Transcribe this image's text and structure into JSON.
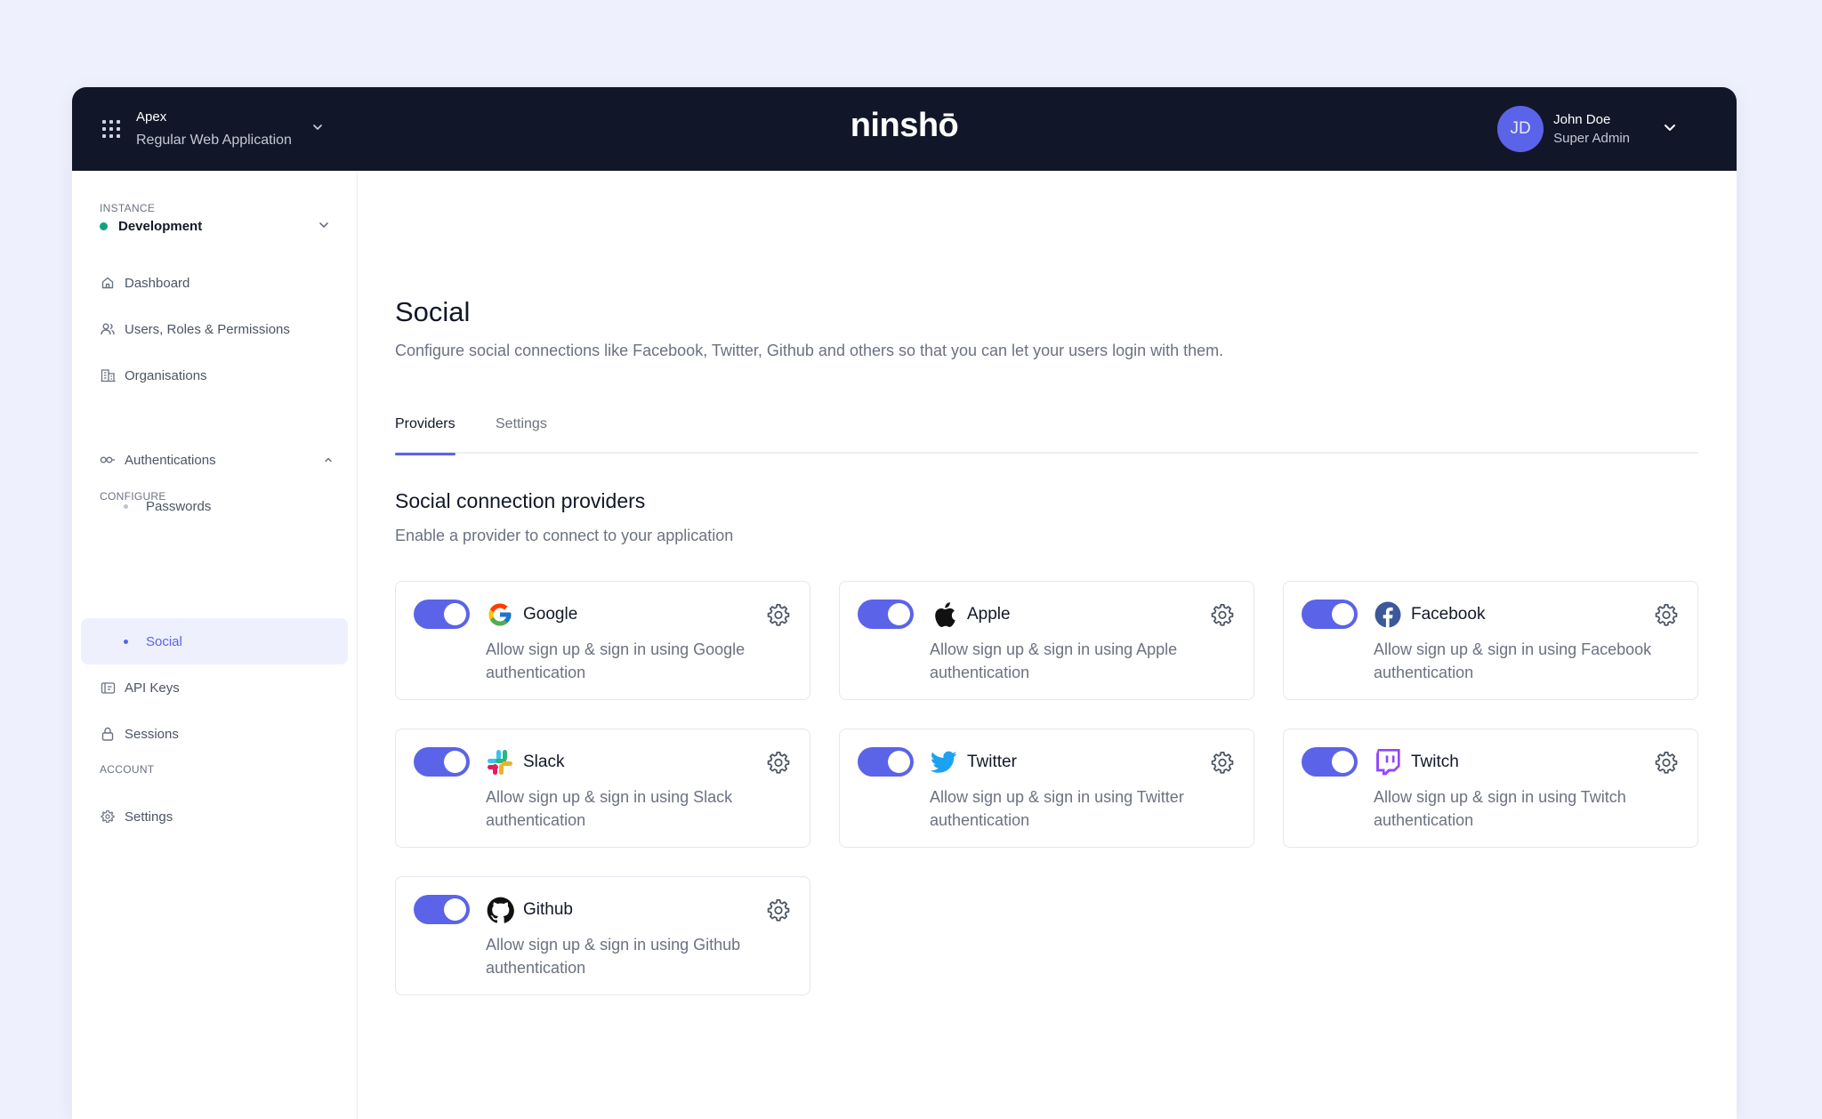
{
  "header": {
    "app_name": "Apex",
    "app_type": "Regular Web Application",
    "logo": "ninshō",
    "user": {
      "initials": "JD",
      "name": "John Doe",
      "role": "Super Admin"
    }
  },
  "sidebar": {
    "instance_label": "INSTANCE",
    "instance_name": "Development",
    "items": [
      {
        "label": "Dashboard",
        "icon": "home-icon"
      },
      {
        "label": "Users, Roles & Permissions",
        "icon": "users-icon"
      },
      {
        "label": "Organisations",
        "icon": "building-icon"
      }
    ],
    "configure_label": "CONFIGURE",
    "authentications": {
      "label": "Authentications",
      "icon": "key-icon",
      "children": [
        {
          "label": "Passwords",
          "active": false
        },
        {
          "label": "Social",
          "active": true
        }
      ]
    },
    "more_items": [
      {
        "label": "API Keys",
        "icon": "api-key-icon"
      },
      {
        "label": "Sessions",
        "icon": "lock-icon"
      }
    ],
    "account_label": "ACCOUNT",
    "settings_label": "Settings"
  },
  "main": {
    "title": "Social",
    "description": "Configure social connections like Facebook, Twitter, Github and others so that you can let your users login with them.",
    "tabs": [
      {
        "label": "Providers",
        "active": true
      },
      {
        "label": "Settings",
        "active": false
      }
    ],
    "section_title": "Social connection providers",
    "section_description": "Enable a provider to connect to your application",
    "providers": [
      {
        "name": "Google",
        "enabled": true,
        "description": "Allow sign up & sign in using Google authentication",
        "icon": "google-icon"
      },
      {
        "name": "Apple",
        "enabled": true,
        "description": "Allow sign up & sign in using Apple authentication",
        "icon": "apple-icon"
      },
      {
        "name": "Facebook",
        "enabled": true,
        "description": "Allow sign up & sign in using Facebook authentication",
        "icon": "facebook-icon"
      },
      {
        "name": "Slack",
        "enabled": true,
        "description": "Allow sign up & sign in using Slack authentication",
        "icon": "slack-icon"
      },
      {
        "name": "Twitter",
        "enabled": true,
        "description": "Allow sign up & sign in using Twitter authentication",
        "icon": "twitter-icon"
      },
      {
        "name": "Twitch",
        "enabled": true,
        "description": "Allow sign up & sign in using Twitch authentication",
        "icon": "twitch-icon"
      },
      {
        "name": "Github",
        "enabled": true,
        "description": "Allow sign up & sign in using Github authentication",
        "icon": "github-icon"
      }
    ]
  },
  "colors": {
    "accent": "#5b63e8",
    "topbar": "#111729",
    "background": "#eef0fd",
    "status_green": "#0ea47a"
  }
}
